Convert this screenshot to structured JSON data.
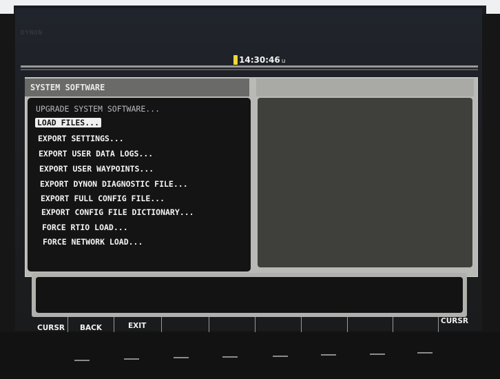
{
  "device": {
    "brand": "DYNON"
  },
  "status_bar": {
    "time": "14:30:46",
    "time_suffix": "u",
    "battery_color": "#f0d63a"
  },
  "panel": {
    "title": "SYSTEM SOFTWARE",
    "menu_items": [
      {
        "label": "UPGRADE SYSTEM SOFTWARE...",
        "state": "dim"
      },
      {
        "label": "LOAD FILES...",
        "state": "selected"
      },
      {
        "label": "EXPORT SETTINGS...",
        "state": "normal"
      },
      {
        "label": "EXPORT USER DATA LOGS...",
        "state": "normal"
      },
      {
        "label": "EXPORT USER WAYPOINTS...",
        "state": "normal"
      },
      {
        "label": "EXPORT DYNON DIAGNOSTIC FILE...",
        "state": "normal"
      },
      {
        "label": "EXPORT FULL CONFIG FILE...",
        "state": "normal"
      },
      {
        "label": "EXPORT CONFIG FILE DICTIONARY...",
        "state": "normal"
      },
      {
        "label": "FORCE RTIO LOAD...",
        "state": "normal"
      },
      {
        "label": "FORCE NETWORK LOAD...",
        "state": "normal"
      }
    ]
  },
  "softkeys": {
    "cursr_left": "CURSR",
    "back": "BACK",
    "exit": "EXIT",
    "cursr_right": "CURSR"
  }
}
